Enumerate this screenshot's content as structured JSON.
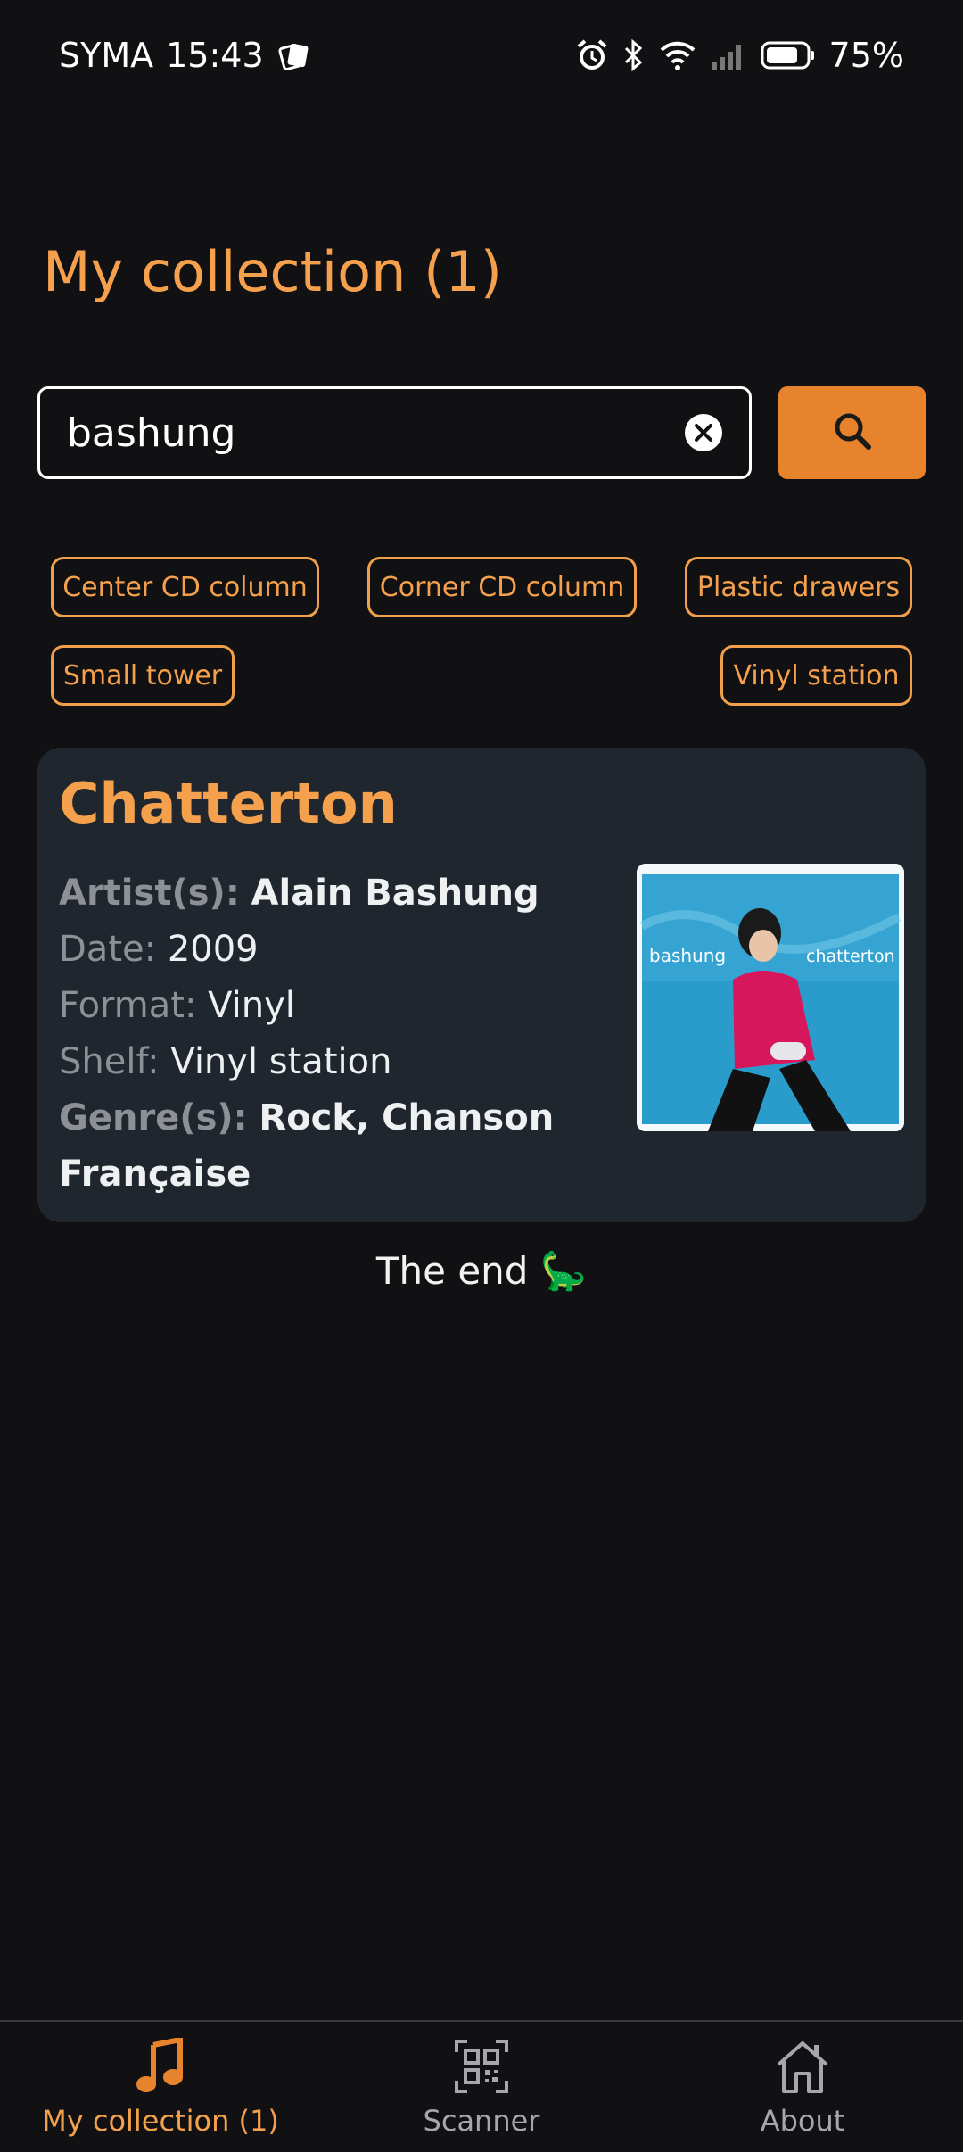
{
  "status_bar": {
    "carrier": "SYMA",
    "time": "15:43",
    "battery": "75%"
  },
  "page": {
    "title": "My collection (1)"
  },
  "search": {
    "value": "bashung"
  },
  "filters": {
    "chips": [
      "Center CD column",
      "Corner CD column",
      "Plastic drawers",
      "Small tower",
      "Vinyl station"
    ]
  },
  "result": {
    "title": "Chatterton",
    "artist_label": "Artist(s):",
    "artist": "Alain Bashung",
    "date_label": "Date:",
    "date": "2009",
    "format_label": "Format:",
    "format": "Vinyl",
    "shelf_label": "Shelf:",
    "shelf": "Vinyl station",
    "genre_label": "Genre(s):",
    "genre": "Rock, Chanson Française",
    "cover_text_left": "bashung",
    "cover_text_right": "chatterton"
  },
  "footer": {
    "end_text": "The end 🦕"
  },
  "bottom_nav": {
    "items": [
      {
        "label": "My collection (1)",
        "icon": "music-note-icon",
        "active": true
      },
      {
        "label": "Scanner",
        "icon": "qr-code-icon",
        "active": false
      },
      {
        "label": "About",
        "icon": "home-icon",
        "active": false
      }
    ]
  },
  "colors": {
    "accent": "#f5a04c",
    "button": "#e8832d",
    "background": "#111113",
    "card": "#1f262e"
  }
}
